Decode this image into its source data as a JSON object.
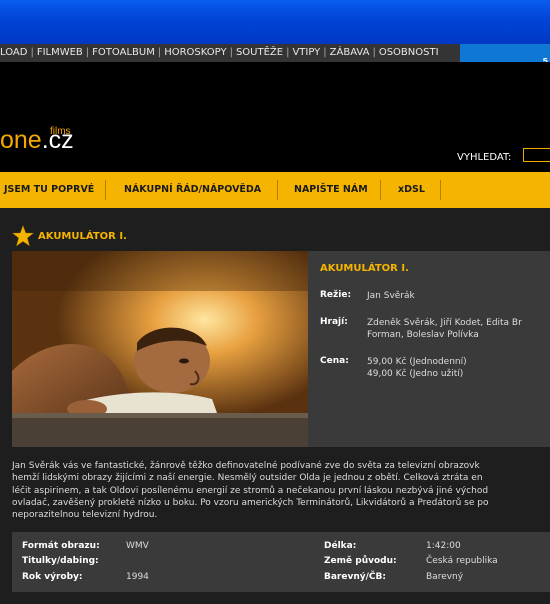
{
  "topnav": {
    "links": [
      "LOAD",
      "FILMWEB",
      "FOTOALBUM",
      "HOROSKOPY",
      "SOUTĚŽE",
      "VTIPY",
      "ZÁBAVA",
      "OSOBNOSTI"
    ],
    "corner_text": "s"
  },
  "logo": {
    "main_one": "one",
    "main_cz": ".cz",
    "sub": "films"
  },
  "search": {
    "label": "VYHLEDAT:"
  },
  "menu": {
    "items": [
      "JSEM TU POPRVÉ",
      "NÁKUPNÍ ŘÁD/NÁPOVĚDA",
      "NAPIŠTE NÁM",
      "xDSL"
    ]
  },
  "page": {
    "title": "AKUMULÁTOR I."
  },
  "info": {
    "title": "AKUMULÁTOR I.",
    "director_label": "Režie:",
    "director": "Jan Svěrák",
    "cast_label": "Hrají:",
    "cast_line1": "Zdeněk Svěrák, Jiří Kodet, Edita Br",
    "cast_line2": "Forman, Boleslav Polívka",
    "price_label": "Cena:",
    "price1": "59,00 Kč (Jednodenní)",
    "price2": "49,00 Kč (Jedno užití)"
  },
  "description": {
    "line1": "Jan Svěrák vás ve fantastické, žánrově těžko definovatelné podívané zve do světa za televizní obrazovk",
    "line2": "hemží lidskými obrazy žijícími z naší energie. Nesmělý outsider Olda je jednou z obětí. Celková ztráta en",
    "line3": "léčit aspirinem, a tak Oldovi posílenému energií ze stromů a nečekanou první láskou nezbývá jiné východ",
    "line4": "ovladač, zavěšený prokleté nízko u boku. Po vzoru amerických Terminátorů, Likvidátorů a Predátorů se po",
    "line5": "neporazitelnou televizní hydrou."
  },
  "details": {
    "format_label": "Formát obrazu:",
    "format": "WMV",
    "subs_label": "Titulky/dabing:",
    "subs": "",
    "year_label": "Rok výroby:",
    "year": "1994",
    "length_label": "Délka:",
    "length": "1:42:00",
    "country_label": "Země původu:",
    "country": "Česká republika",
    "color_label": "Barevný/ČB:",
    "color": "Barevný"
  },
  "colors": {
    "accent": "#f5b400",
    "titlebar": "#0044d6",
    "panel": "#3a3a3a"
  }
}
